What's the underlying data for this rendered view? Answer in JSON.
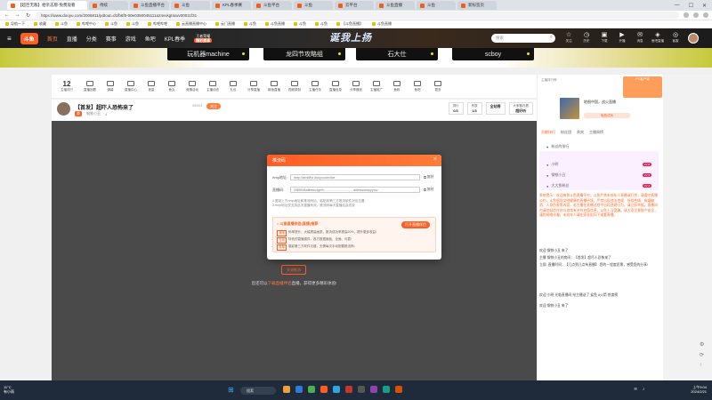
{
  "browser": {
    "active_tab": "【超巨无敌】相亲志愿-免费观看",
    "tabs": [
      "待续",
      "斗鱼直播平台",
      "斗鱼",
      "KPL春季赛",
      "斗鱼平台",
      "斗鱼",
      "云平台",
      "斗鱼直播",
      "斗鱼",
      "新标签页"
    ],
    "url": "https://www.douyu.com/2006811/pdtout=d1fb6f5-00e0350045111a24vvkgtIuwv00011f31",
    "bookmarks": [
      "导航一下",
      "收藏",
      "斗鱼",
      "哔哩中心",
      "斗鱼",
      "斗鱼",
      "哔哩哔哩",
      "云直播直播中心",
      "云门直播",
      "斗鱼",
      "斗鱼直播",
      "斗鱼",
      "斗鱼",
      "【斗鱼直播】",
      "斗鱼直播"
    ]
  },
  "site": {
    "logo": "斗鱼",
    "nav": [
      "首页",
      "直播",
      "分类",
      "赛事",
      "游戏",
      "鱼吧",
      "KPL春季"
    ],
    "promo_top": "王者荣耀",
    "promo_bottom": "精彩赛事",
    "banner_title": "诞我上扬",
    "search_placeholder": "搜索",
    "header_icons": [
      {
        "glyph": "☆",
        "label": "关注"
      },
      {
        "glyph": "◷",
        "label": "历史"
      },
      {
        "glyph": "▣",
        "label": "下载"
      },
      {
        "glyph": "▶",
        "label": "开播"
      },
      {
        "glyph": "✉",
        "label": "消息"
      },
      {
        "glyph": "◈",
        "label": "鱼吧直播"
      },
      {
        "glyph": "◎",
        "label": "客服"
      }
    ]
  },
  "stream_buttons": [
    "玩机器machine",
    "龙四节攻略组",
    "石大仕",
    "scboy"
  ],
  "room": {
    "hot_value": "12",
    "hot_label": "主播排行",
    "tools": [
      "直播回看",
      "弹幕",
      "直播中心",
      "音量",
      "鱼丸",
      "竞猜活动",
      "主播动态",
      "礼包",
      "分享直播",
      "新版直播",
      "视频录制",
      "主播任务",
      "直播信息",
      "分享赚钱",
      "主播推广",
      "鱼粉",
      "鱼吧",
      "更多"
    ],
    "title": "【首发】超吓人恐怖来了",
    "tag": "赛",
    "anchor": "钢铁小丑",
    "viewers": "4",
    "room_no": "98593",
    "follow": "关注",
    "stat1_label": "排行",
    "stat1": "0/3",
    "stat2_label": "贵族",
    "stat2": "1/3",
    "stat3": "全站榜",
    "stat4_label": "大家都在看",
    "stat4": "超好听"
  },
  "modal": {
    "title": "推流码",
    "rtmp_label": "rtmp地址:",
    "rtmp_value": "rtmp://sendfhz.douyu.com/live",
    "key_label": "直播码:",
    "key_value": "2085945a8bedc4ge9=  ...............................  &liteswzwxppymv",
    "copy_label": "复制",
    "note1": "1.复制上方rtmp地址和推流码后，粘贴到第三方推流软件对应位置",
    "note2": "2.rtmp地址仅支持此次直播有效，推流码每次直播后会改变",
    "promo_title": "斗鱼直播伴侣(直播)推荐",
    "promo_btn": "打开直播伴侣",
    "promo_lines": [
      {
        "tag": "清晰",
        "text": "码率提升，大幅提高画质，推流成功率提高20%，提升更多收益!"
      },
      {
        "tag": "互动",
        "text": "特色的直播插件，各方数据面板、全面、可靠!"
      },
      {
        "tag": "简单",
        "text": "摄影第三方软件无缝，无需每次手动配置推流码!"
      }
    ]
  },
  "player": {
    "open_button": "关闭推流",
    "hint_prefix": "您还可以",
    "hint_link": "下载直播伴侣",
    "hint_suffix": "直播，获得更多精彩体验!"
  },
  "right_panel": {
    "rank_label": "主播排行榜",
    "game_name": "地图中国，战火直播",
    "game_btn": "免费试玩",
    "ad_text": "PC客户端",
    "tabs": [
      "贡献排行",
      "粉丝团",
      "贵宾",
      "主播周榜"
    ],
    "fans": [
      {
        "name": "小明",
        "badge": "LV 8"
      },
      {
        "name": "钢铁小丑",
        "badge": "LV 6"
      },
      {
        "name": "大大鱼粉丝",
        "badge": "LV 4"
      }
    ],
    "fans_header": "粉丝的排行",
    "system_notice": "系统提示：欢迎来到斗鱼直播平台，斗鱼严禁未成年人直播或打赏，请遵守直播公约，斗鱼倡导文明健康的直播环境，严禁出现违法违规、低俗色情、吸烟酗酒、人身伤害等内容，若主播在直播过程中出现违规行为，请立即举报。直播间内请勿轻信任何与游戏有关的充值信息，以免上当受骗。请大家注意财产安全，谨防网络诈骗，未成年人请在家长陪同下观看直播。",
    "msg1": "欢迎 钢铁小丑 来了",
    "msg2": "主播 钢铁小丑的房间：【首发】超吓人恐怖来了",
    "msg3": "立即: 直播时间：【几点到几点有直播】 您的一程度愿景，感受您的分享!",
    "msg4": "欢迎 小明 光临直播间 给主播送了 鲨鱼 #火箭 热度榜",
    "msg5": "欢迎 钢铁小丑 来了"
  },
  "taskbar": {
    "weather_temp": "11°C",
    "weather_text": "有小雨",
    "search": "搜索",
    "time": "上午9:04",
    "date": "2024/2/21"
  }
}
